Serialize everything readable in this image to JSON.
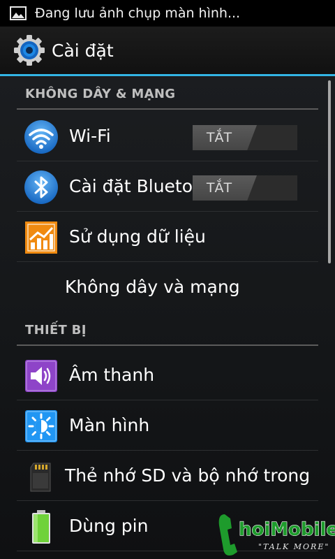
{
  "status_bar": {
    "notification_icon": "image-icon",
    "text": "Đang lưu ảnh chụp màn hình..."
  },
  "action_bar": {
    "icon": "settings-gear-icon",
    "title": "Cài đặt"
  },
  "sections": {
    "wireless": {
      "header": "KHÔNG DÂY & MẠNG",
      "items": {
        "wifi": {
          "icon": "wifi-icon",
          "label": "Wi-Fi",
          "toggle": "TẮT"
        },
        "bluetooth": {
          "icon": "bluetooth-icon",
          "label": "Cài đặt Bluetooth",
          "toggle": "TẮT"
        },
        "data_usage": {
          "icon": "data-usage-chart-icon",
          "label": "Sử dụng dữ liệu"
        },
        "more": {
          "label": "Không dây và mạng"
        }
      }
    },
    "device": {
      "header": "THIẾT BỊ",
      "items": {
        "sound": {
          "icon": "volume-icon",
          "label": "Âm thanh"
        },
        "display": {
          "icon": "brightness-icon",
          "label": "Màn hình"
        },
        "storage": {
          "icon": "sd-card-icon",
          "label": "Thẻ nhớ SD và bộ nhớ trong"
        },
        "battery": {
          "icon": "battery-icon",
          "label": "Dùng pin"
        }
      }
    }
  },
  "watermark": {
    "brand": "ChoiMobile",
    "tagline": "\"TALK MORE\""
  },
  "colors": {
    "accent": "#33b5e5",
    "wifi_blue": "#1e88e5",
    "data_orange": "#f08a10",
    "sound_purple": "#8e44c8",
    "battery_green": "#6fd23a",
    "watermark_green": "#1e9b2c"
  }
}
